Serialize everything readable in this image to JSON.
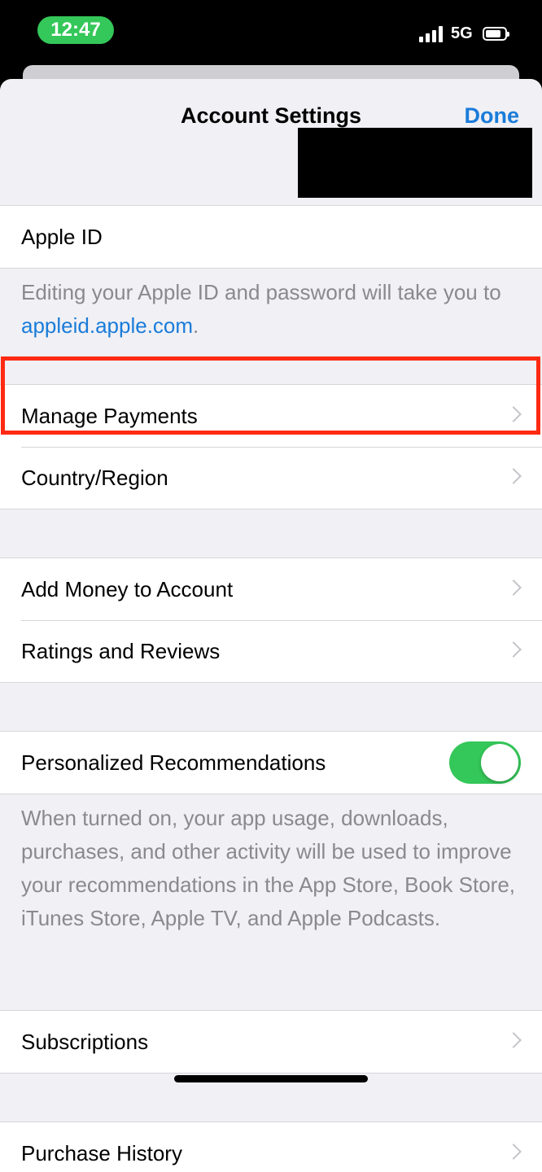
{
  "status_bar": {
    "time": "12:47",
    "network": "5G"
  },
  "header": {
    "title": "Account Settings",
    "done_label": "Done"
  },
  "apple_id": {
    "label": "Apple ID",
    "note_prefix": "Editing your Apple ID and password will take you to ",
    "note_link": "appleid.apple.com",
    "note_suffix": "."
  },
  "group_payments": {
    "items": [
      {
        "label": "Manage Payments"
      },
      {
        "label": "Country/Region"
      }
    ]
  },
  "group_account": {
    "items": [
      {
        "label": "Add Money to Account"
      },
      {
        "label": "Ratings and Reviews"
      }
    ]
  },
  "personalized": {
    "label": "Personalized Recommendations",
    "enabled": true,
    "note": "When turned on, your app usage, downloads, purchases, and other activity will be used to improve your recommendations in the App Store, Book Store, iTunes Store, Apple TV, and Apple Podcasts."
  },
  "subscriptions": {
    "label": "Subscriptions"
  },
  "purchase_history": {
    "label": "Purchase History"
  },
  "colors": {
    "accent": "#1a7cd9",
    "toggle_on": "#34c759",
    "highlight": "#ff2a12",
    "time_pill": "#34c759"
  }
}
